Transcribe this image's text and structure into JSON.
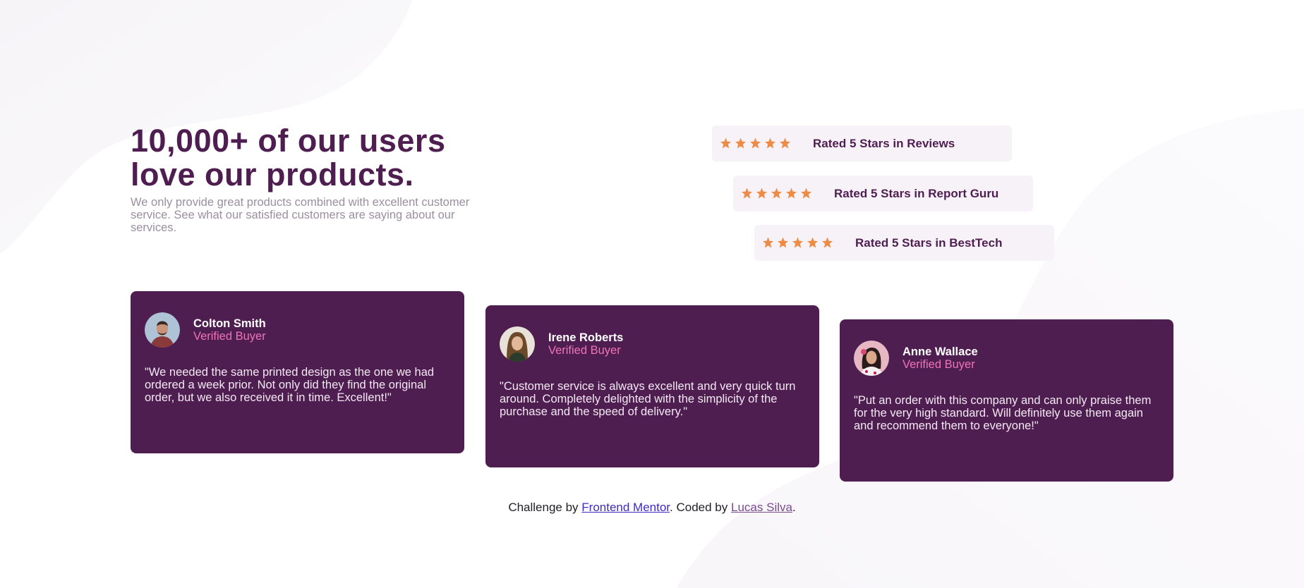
{
  "intro": {
    "title": "10,000+ of our users love our products.",
    "description": "We only provide great products combined with excellent customer service. See what our satisfied customers are saying about our services."
  },
  "ratings": [
    {
      "label": "Rated 5 Stars in Reviews",
      "stars": 5
    },
    {
      "label": "Rated 5 Stars in Report Guru",
      "stars": 5
    },
    {
      "label": "Rated 5 Stars in BestTech",
      "stars": 5
    }
  ],
  "testimonials": [
    {
      "name": "Colton Smith",
      "role": "Verified Buyer",
      "quote": "\"We needed the same printed design as the one we had ordered a week prior. Not only did they find the original order, but we also received it in time. Excellent!\""
    },
    {
      "name": "Irene Roberts",
      "role": "Verified Buyer",
      "quote": "\"Customer service is always excellent and very quick turn around. Completely delighted with the simplicity of the purchase and the speed of delivery.\""
    },
    {
      "name": "Anne Wallace",
      "role": "Verified Buyer",
      "quote": "\"Put an order with this company and can only praise them for the very high standard. Will definitely use them again and recommend them to everyone!\""
    }
  ],
  "footer": {
    "prefix": "Challenge by",
    "link1": "Frontend Mentor",
    "middle": ". Coded by",
    "link2": "Lucas Silva",
    "suffix": "."
  },
  "colors": {
    "primary": "#4f1e51",
    "accent": "#ee74b6",
    "star": "#ee8b45",
    "rating_bg": "#f7f2f8"
  },
  "icons": {
    "rating_star": "star-icon"
  }
}
